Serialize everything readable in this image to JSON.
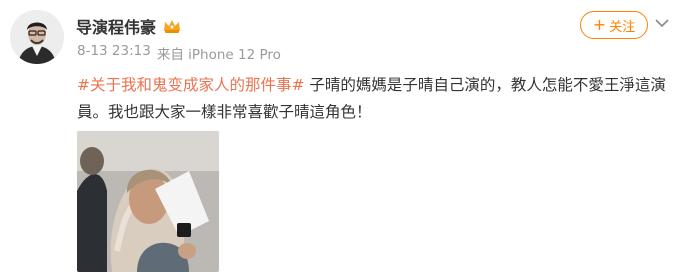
{
  "user": {
    "name": "导演程伟豪",
    "badge_icon": "crown-icon",
    "timestamp": "8-13 23:13",
    "source": "来自 iPhone 12 Pro"
  },
  "actions": {
    "follow_plus": "+",
    "follow_label": "关注",
    "more_icon": "chevron-down-icon"
  },
  "post": {
    "topic": "#关于我和鬼变成家人的那件事#",
    "body": " 子晴的媽媽是子晴自己演的，教人怎能不愛王淨這演員。我也跟大家一樣非常喜歡子晴這角色！"
  },
  "colors": {
    "accent": "#ff8200",
    "topic": "#eb7350",
    "meta": "#9a9a9a"
  }
}
